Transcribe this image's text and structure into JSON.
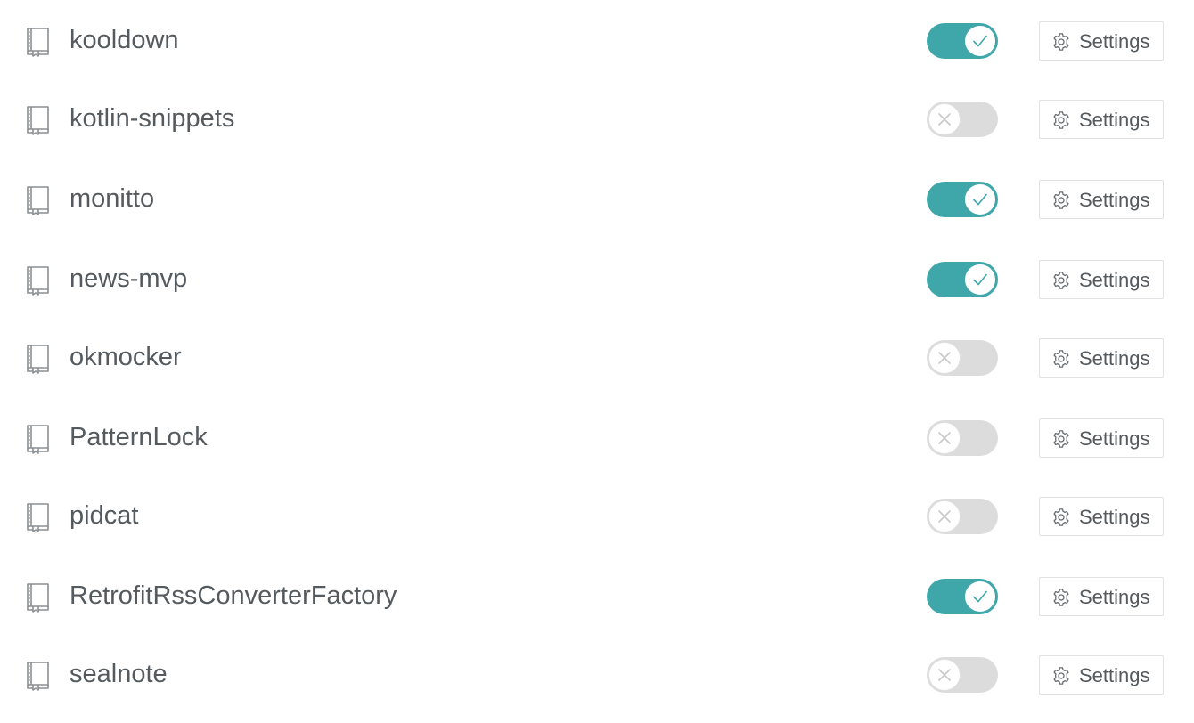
{
  "repos": [
    {
      "name": "kooldown",
      "enabled": true,
      "settings_label": "Settings",
      "state_icon": "check-icon"
    },
    {
      "name": "kotlin-snippets",
      "enabled": false,
      "settings_label": "Settings",
      "state_icon": "x-icon"
    },
    {
      "name": "monitto",
      "enabled": true,
      "settings_label": "Settings",
      "state_icon": "check-icon"
    },
    {
      "name": "news-mvp",
      "enabled": true,
      "settings_label": "Settings",
      "state_icon": "check-icon"
    },
    {
      "name": "okmocker",
      "enabled": false,
      "settings_label": "Settings",
      "state_icon": "x-icon"
    },
    {
      "name": "PatternLock",
      "enabled": false,
      "settings_label": "Settings",
      "state_icon": "x-icon"
    },
    {
      "name": "pidcat",
      "enabled": false,
      "settings_label": "Settings",
      "state_icon": "x-icon"
    },
    {
      "name": "RetrofitRssConverterFactory",
      "enabled": true,
      "settings_label": "Settings",
      "state_icon": "check-icon"
    },
    {
      "name": "sealnote",
      "enabled": false,
      "settings_label": "Settings",
      "state_icon": "x-icon"
    }
  ],
  "icons": {
    "repo": "repo-book-icon",
    "settings": "gear-icon"
  },
  "colors": {
    "toggle_on": "#3fa7a9",
    "toggle_off": "#dcdcdc",
    "text": "#555a5e"
  }
}
